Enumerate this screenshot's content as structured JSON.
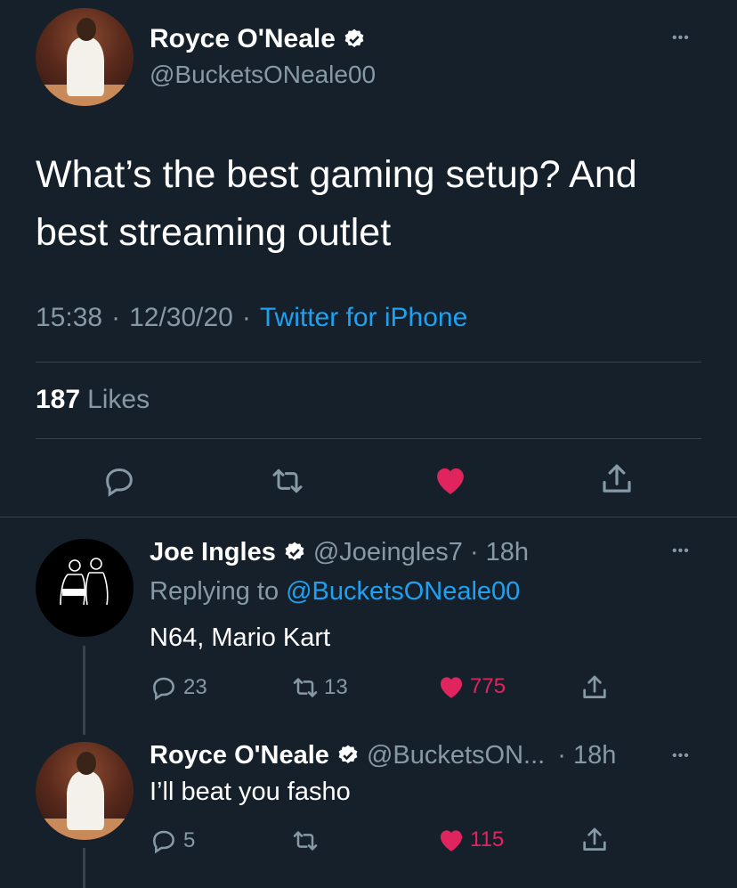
{
  "main_tweet": {
    "author_name": "Royce O'Neale",
    "handle": "@BucketsONeale00",
    "text_line1": "What’s the best gaming setup? And",
    "text_line2": "best streaming outlet",
    "time": "15:38",
    "date": "12/30/20",
    "separator": "·",
    "source": "Twitter for iPhone",
    "likes_count": "187",
    "likes_label": "Likes",
    "more_label": "•••"
  },
  "replies": [
    {
      "author_name": "Joe Ingles",
      "handle": "@Joeingles7",
      "age": "· 18h",
      "replying_prefix": "Replying to",
      "replying_handle": "@BucketsONeale00",
      "text": "N64, Mario Kart",
      "reply_count": "23",
      "retweet_count": "13",
      "like_count": "775",
      "more_label": "•••"
    },
    {
      "author_name": "Royce O'Neale",
      "handle": "@BucketsON...",
      "age": "· 18h",
      "text": "I’ll beat you fasho",
      "reply_count": "5",
      "like_count": "115",
      "more_label": "•••"
    }
  ],
  "colors": {
    "background": "#15202b",
    "muted": "#8899a6",
    "accent": "#1da1f2",
    "like": "#e0245e"
  }
}
